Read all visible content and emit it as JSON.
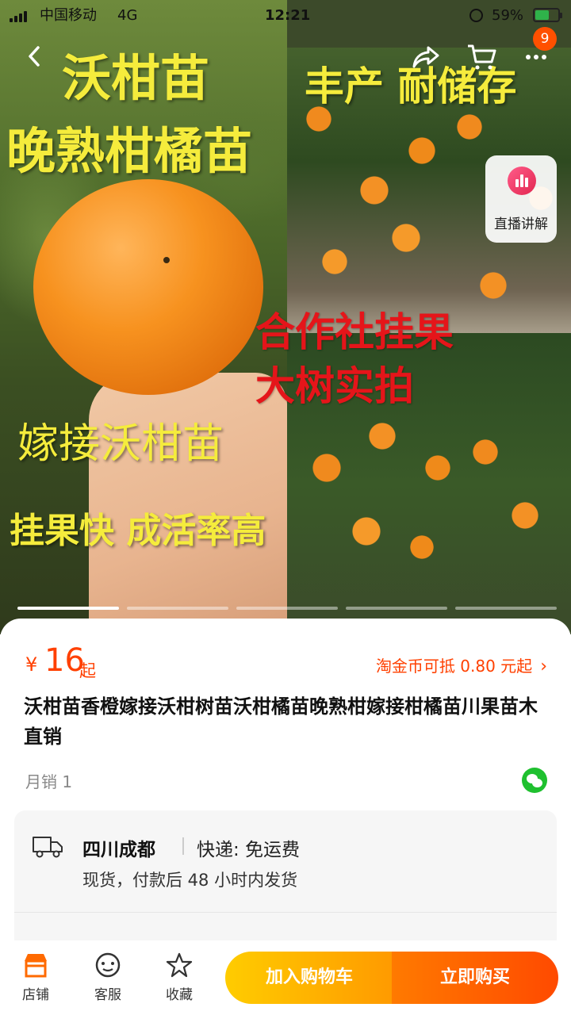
{
  "status_bar": {
    "carrier": "中国移动",
    "network": "4G",
    "time": "12:21",
    "battery": "59%"
  },
  "nav": {
    "cart_badge": "9",
    "icons": [
      "back-icon",
      "share-icon",
      "cart-icon",
      "more-icon"
    ]
  },
  "hero": {
    "text_title_1": "沃柑苗",
    "text_title_2": "晚熟柑橘苗",
    "text_feature_1": "丰产 耐储存",
    "text_coop_1": "合作社挂果",
    "text_coop_2": "大树实拍",
    "text_graft": "嫁接沃柑苗",
    "text_benefit": "挂果快 成活率高",
    "live_label": "直播讲解",
    "page_count": 5,
    "active_page": 1
  },
  "product": {
    "currency": "¥",
    "price": "16",
    "price_suffix": "起",
    "coin_offer": "淘金币可抵 0.80 元起",
    "title": "沃柑苗香橙嫁接沃柑树苗沃柑橘苗晚熟柑嫁接柑橘苗川果苗木直销",
    "monthly_sales": "月销 1"
  },
  "shipping": {
    "location": "四川成都",
    "method": "快递: 免运费",
    "note": "现货，付款后 48 小时内发货"
  },
  "bottom_bar": {
    "store_label": "店铺",
    "service_label": "客服",
    "favorite_label": "收藏",
    "add_to_cart_label": "加入购物车",
    "buy_now_label": "立即购买"
  },
  "colors": {
    "accent": "#ff4000",
    "cart_button": "#ffb400",
    "buy_button": "#ff5a00",
    "wechat": "#1fc02f"
  }
}
